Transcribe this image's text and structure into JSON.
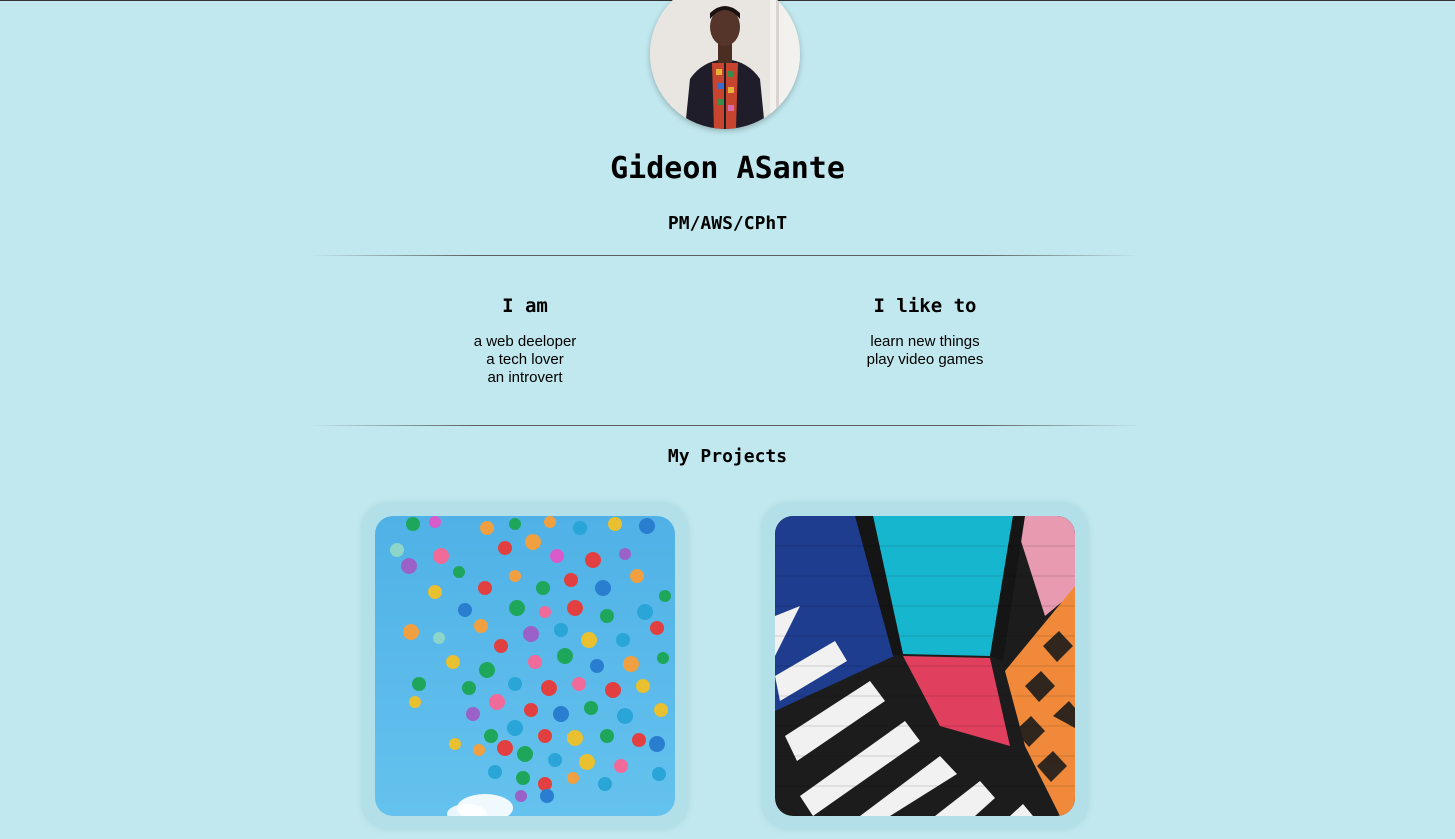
{
  "profile": {
    "name": "Gideon ASante",
    "role": "PM/AWS/CPhT"
  },
  "about": {
    "i_am": {
      "heading": "I am",
      "items": [
        "a web deeloper",
        "a tech lover",
        "an introvert"
      ]
    },
    "i_like": {
      "heading": "I like to",
      "items": [
        "learn new things",
        "play video games"
      ]
    }
  },
  "projects": {
    "title": "My Projects"
  },
  "colors": {
    "background": "#c0e8ee",
    "card": "#b3e0e8"
  }
}
